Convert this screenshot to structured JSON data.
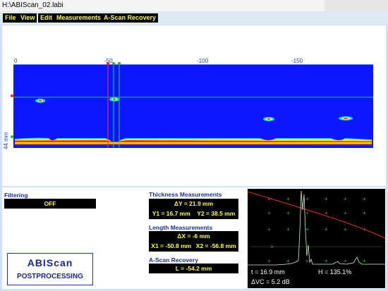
{
  "window": {
    "title": "H:\\ABIScan_02.labi"
  },
  "menu": [
    {
      "label": "File"
    },
    {
      "label": "View"
    },
    {
      "label": "Edit"
    },
    {
      "label": "Measurements"
    },
    {
      "label": "A-Scan Recovery"
    }
  ],
  "bscan": {
    "x_ticks": [
      "0",
      "-50",
      "-100",
      "-150"
    ],
    "y_label": "44 mm",
    "colors": {
      "background": "#0b18ff",
      "cursor_red": "#ff2020",
      "cursor_green": "#20d020",
      "hline": "#30c030"
    }
  },
  "filtering": {
    "label": "Filtering",
    "value": "OFF"
  },
  "thickness": {
    "label": "Thickness Measurements",
    "delta": "ΔY = 21.9 mm",
    "y1": "Y1 = 16.7 mm",
    "y2": "Y2 = 38.5 mm"
  },
  "length": {
    "label": "Length Measurements",
    "delta": "ΔX = -6 mm",
    "x1": "X1 = -50.8 mm",
    "x2": "X2 = -56.8 mm"
  },
  "ascan_recovery": {
    "label": "A-Scan Recovery",
    "value": "L = -54.2 mm"
  },
  "logo": {
    "line1": "ABIScan",
    "line2": "POSTPROCESSING"
  },
  "ascan": {
    "t": "t = 16.9 mm",
    "h": "H = 135.1%",
    "dvc": "ΔVC = 5.2 dB"
  }
}
